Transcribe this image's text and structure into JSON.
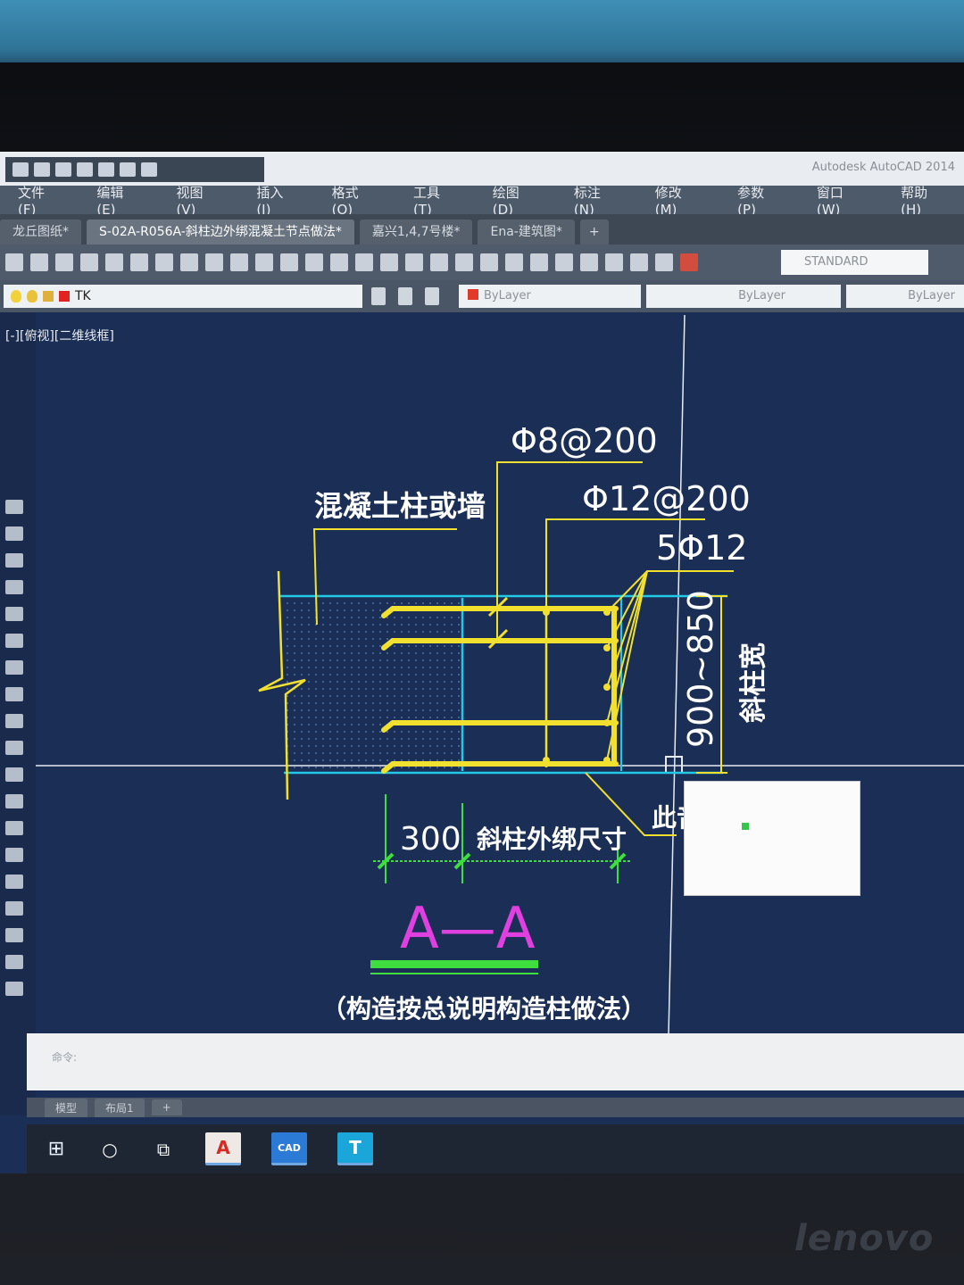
{
  "window": {
    "app_title": "Autodesk AutoCAD 2014"
  },
  "menu": [
    "文件(F)",
    "编辑(E)",
    "视图(V)",
    "插入(I)",
    "格式(O)",
    "工具(T)",
    "绘图(D)",
    "标注(N)",
    "修改(M)",
    "参数(P)",
    "窗口(W)",
    "帮助(H)"
  ],
  "tabs": [
    {
      "label": "龙丘图纸*"
    },
    {
      "label": "S-02A-R056A-斜柱边外绑混凝土节点做法*"
    },
    {
      "label": "嘉兴1,4,7号楼*"
    },
    {
      "label": "Ena-建筑图*"
    },
    {
      "label": "+"
    }
  ],
  "toolbar": {
    "text_style": "STANDARD"
  },
  "properties": {
    "layer": "TK",
    "color": "ByLayer",
    "linetype": "ByLayer",
    "lineweight": "ByLayer"
  },
  "viewport": {
    "label": "[-][俯视][二维线框]"
  },
  "drawing": {
    "label_rebar_8": "Φ8@200",
    "label_concrete": "混凝土柱或墙",
    "label_rebar_12": "Φ12@200",
    "label_rebar_5": "5Φ12",
    "dim_vertical": "900~850",
    "label_column_width": "斜柱宽",
    "dim_300": "300",
    "dim_outer": "斜柱外绑尺寸",
    "label_partial": "此音",
    "section_title": "A—A",
    "note": "（构造按总说明构造柱做法）"
  },
  "command": {
    "prompt": "命令:"
  },
  "layout_tabs": [
    "模型",
    "布局1",
    "+"
  ],
  "taskbar": {
    "start": "⊞",
    "search": "○",
    "taskview": "⧉",
    "app1": "A",
    "app2": "CAD",
    "app3": "T"
  },
  "brand": "lenovo",
  "colors": {
    "canvas": "#1b2f56",
    "rebar": "#f2e02e",
    "cyan": "#22c8e6",
    "magenta": "#e040e0",
    "green": "#3dde3d"
  }
}
